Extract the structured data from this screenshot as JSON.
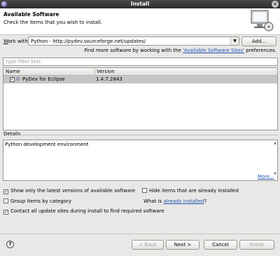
{
  "window": {
    "title": "Install"
  },
  "header": {
    "title": "Available Software",
    "description": "Check the items that you wish to install."
  },
  "work_with": {
    "label_first": "W",
    "label_rest": "ork with:",
    "value": "Python - http://pydev.sourceforge.net/updates/",
    "add_label": "Add..."
  },
  "find_more": {
    "prefix": "Find more software by working with the ",
    "link": "'Available Software Sites'",
    "suffix": " preferences."
  },
  "filter": {
    "placeholder": "type filter text"
  },
  "table": {
    "columns": [
      "Name",
      "Version"
    ],
    "rows": [
      {
        "name": "PyDev for Eclipse",
        "version": "1.4.7.2843",
        "checked": true,
        "expanded": false
      }
    ]
  },
  "details": {
    "label": "Details",
    "text": "Python development environment",
    "more": "More..."
  },
  "options": {
    "latest_only": "Show only the latest versions of available software",
    "hide_installed": "Hide items that are already installed",
    "group_by_category": "Group items by category",
    "what_is_prefix": "What is ",
    "what_is_link": "already installed",
    "what_is_suffix": "?",
    "contact_sites": "Contact all update sites during install to find required software"
  },
  "buttons": {
    "help": "?",
    "back": "< Back",
    "next": "Next >",
    "cancel": "Cancel",
    "finish": "Finish"
  }
}
